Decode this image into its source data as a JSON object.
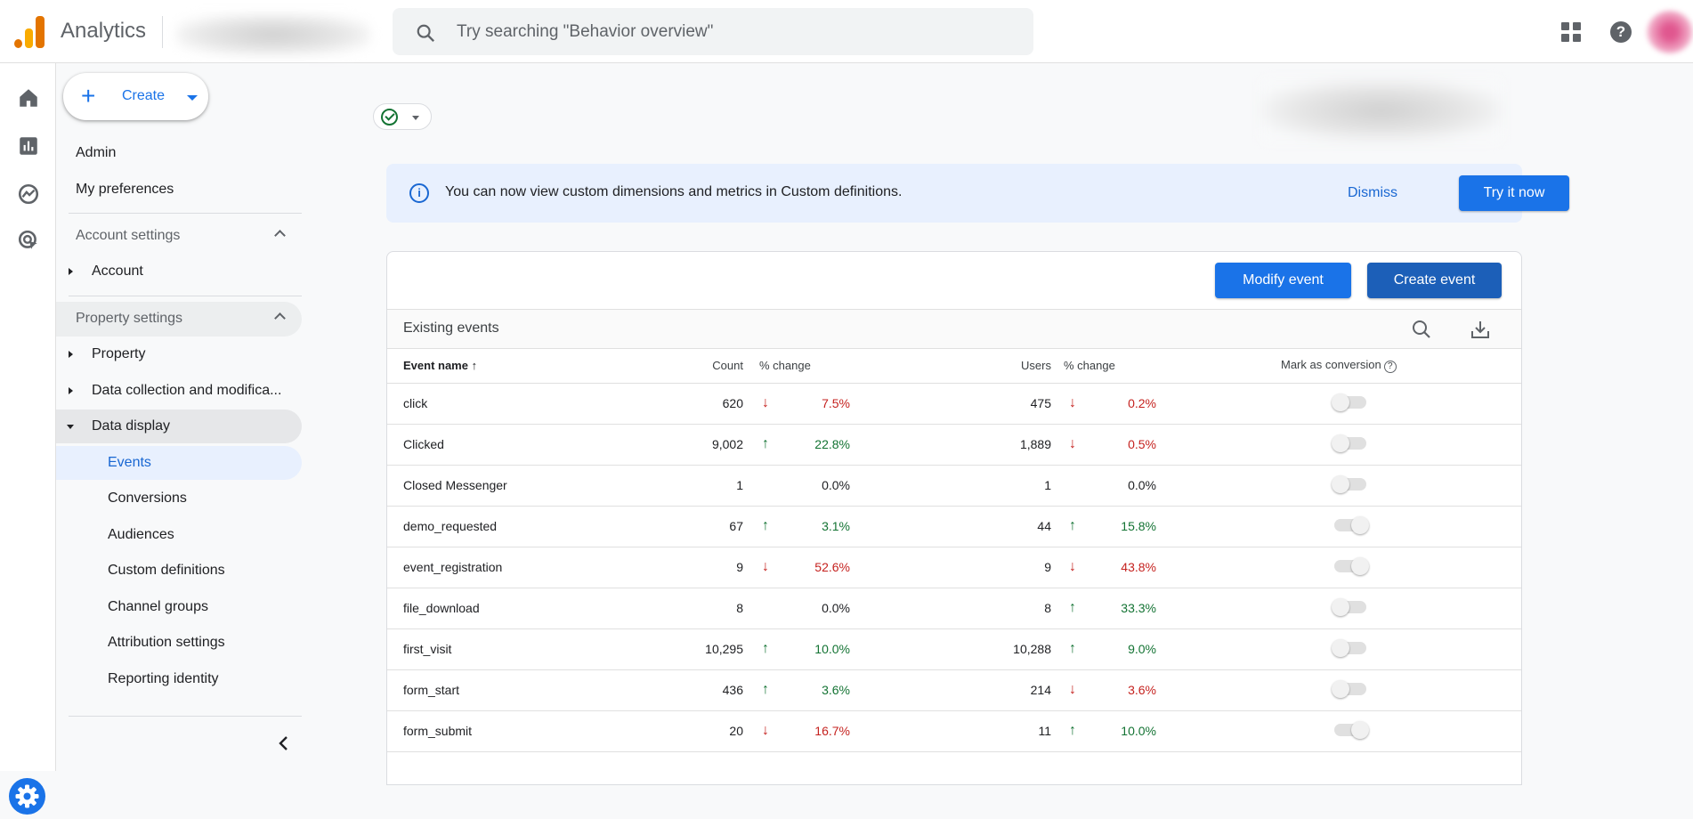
{
  "app": {
    "title": "Analytics"
  },
  "search": {
    "placeholder": "Try searching \"Behavior overview\""
  },
  "topbar": {
    "apps_icon": "grid-icon",
    "help_icon": "help-icon",
    "help_glyph": "?"
  },
  "sidebar": {
    "create_label": "Create",
    "admin_label": "Admin",
    "preferences_label": "My preferences",
    "account_settings_label": "Account settings",
    "account_label": "Account",
    "property_settings_label": "Property settings",
    "property_label": "Property",
    "data_collection_label": "Data collection and modifica...",
    "data_display_label": "Data display",
    "subitems": [
      "Events",
      "Conversions",
      "Audiences",
      "Custom definitions",
      "Channel groups",
      "Attribution settings",
      "Reporting identity"
    ],
    "active_subitem": "Events"
  },
  "banner": {
    "info_glyph": "i",
    "message": "You can now view custom dimensions and metrics in Custom definitions.",
    "dismiss_label": "Dismiss",
    "try_label": "Try it now"
  },
  "events_card": {
    "modify_label": "Modify event",
    "create_label": "Create event",
    "heading": "Existing events",
    "columns": {
      "event_name": "Event name",
      "sort_glyph": "↑",
      "count": "Count",
      "count_change": "% change",
      "users": "Users",
      "users_change": "% change",
      "mark_conversion": "Mark as conversion",
      "help_glyph": "?"
    },
    "rows": [
      {
        "name": "click",
        "count": "620",
        "count_dir": "down",
        "count_pct": "7.5%",
        "users": "475",
        "users_dir": "down",
        "users_pct": "0.2%",
        "conversion": false
      },
      {
        "name": "Clicked",
        "count": "9,002",
        "count_dir": "up",
        "count_pct": "22.8%",
        "users": "1,889",
        "users_dir": "down",
        "users_pct": "0.5%",
        "conversion": false
      },
      {
        "name": "Closed Messenger",
        "count": "1",
        "count_dir": "flat",
        "count_pct": "0.0%",
        "users": "1",
        "users_dir": "flat",
        "users_pct": "0.0%",
        "conversion": false
      },
      {
        "name": "demo_requested",
        "count": "67",
        "count_dir": "up",
        "count_pct": "3.1%",
        "users": "44",
        "users_dir": "up",
        "users_pct": "15.8%",
        "conversion": true
      },
      {
        "name": "event_registration",
        "count": "9",
        "count_dir": "down",
        "count_pct": "52.6%",
        "users": "9",
        "users_dir": "down",
        "users_pct": "43.8%",
        "conversion": true
      },
      {
        "name": "file_download",
        "count": "8",
        "count_dir": "flat",
        "count_pct": "0.0%",
        "users": "8",
        "users_dir": "up",
        "users_pct": "33.3%",
        "conversion": false
      },
      {
        "name": "first_visit",
        "count": "10,295",
        "count_dir": "up",
        "count_pct": "10.0%",
        "users": "10,288",
        "users_dir": "up",
        "users_pct": "9.0%",
        "conversion": false
      },
      {
        "name": "form_start",
        "count": "436",
        "count_dir": "up",
        "count_pct": "3.6%",
        "users": "214",
        "users_dir": "down",
        "users_pct": "3.6%",
        "conversion": false
      },
      {
        "name": "form_submit",
        "count": "20",
        "count_dir": "down",
        "count_pct": "16.7%",
        "users": "11",
        "users_dir": "up",
        "users_pct": "10.0%",
        "conversion": true
      }
    ]
  },
  "colors": {
    "accent": "#1a73e8",
    "up": "#137333",
    "down": "#c5221f",
    "banner_bg": "#e8f0fe"
  }
}
